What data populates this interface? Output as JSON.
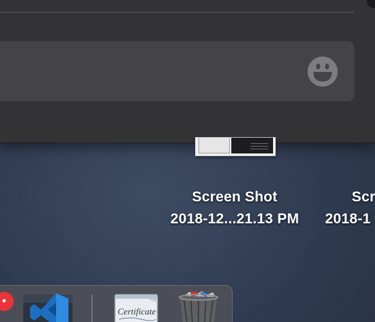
{
  "messages_window": {
    "input_placeholder": "",
    "emoji_button_icon": "smiley-face-icon"
  },
  "desktop": {
    "files": [
      {
        "name_line1": "Screen Shot",
        "name_line2": "2018-12...21.13 PM"
      },
      {
        "name_line1": "Scr",
        "name_line2": "2018-1"
      }
    ]
  },
  "dock": {
    "apps": [
      {
        "icon": "red-app-icon"
      },
      {
        "icon": "visual-studio-code-icon"
      },
      {
        "icon": "certificate-document-icon",
        "label_text": "Certificate"
      },
      {
        "icon": "trash-full-icon"
      }
    ]
  },
  "colors": {
    "window_bg": "#333336",
    "input_bg": "#444447",
    "desktop_bg": "#2e3a50",
    "dock_bg": "#525258",
    "accent_blue": "#2f7dd1"
  }
}
